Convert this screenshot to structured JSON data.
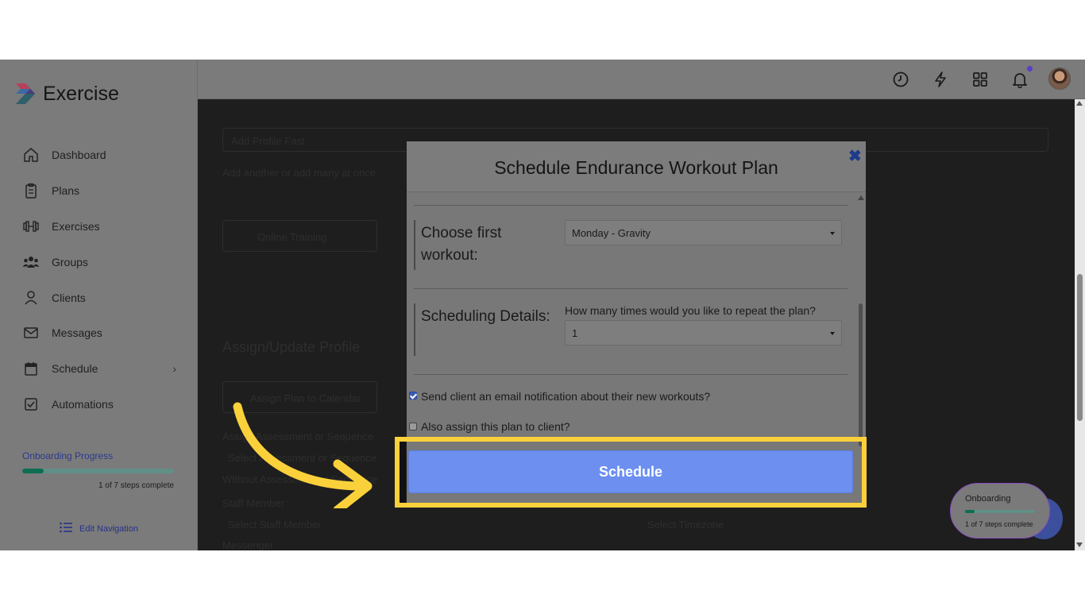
{
  "app": {
    "name": "Exercise"
  },
  "sidebar": {
    "items": [
      {
        "label": "Dashboard",
        "icon": "home-icon"
      },
      {
        "label": "Plans",
        "icon": "clipboard-icon"
      },
      {
        "label": "Exercises",
        "icon": "dumbbell-icon"
      },
      {
        "label": "Groups",
        "icon": "groups-icon"
      },
      {
        "label": "Clients",
        "icon": "user-icon"
      },
      {
        "label": "Messages",
        "icon": "mail-icon"
      },
      {
        "label": "Schedule",
        "icon": "calendar-icon"
      },
      {
        "label": "Automations",
        "icon": "checkbox-icon"
      }
    ],
    "onboarding": {
      "title": "Onboarding Progress",
      "steps": "1 of 7 steps complete",
      "progress": 0.14
    },
    "edit_nav": "Edit Navigation"
  },
  "topbar": {
    "icons": [
      "clock-icon",
      "bolt-icon",
      "grid-icon",
      "bell-icon",
      "avatar"
    ]
  },
  "background_page": {
    "texts": [
      "Add Profile Fast",
      "Add another or add many at once",
      "Online Training",
      "Assign/Update Profile",
      "Assign Plan to Calendar",
      "Assign Assessment or Sequence",
      "Select Assessment or Sequence",
      "Without Assessment or Sequence",
      "Staff Member",
      "Select Staff Member",
      "Select Timezone",
      "Messenger"
    ]
  },
  "modal": {
    "title": "Schedule Endurance Workout Plan",
    "close_icon": "close-icon",
    "first_workout": {
      "label": "Choose first workout:",
      "value": "Monday - Gravity"
    },
    "scheduling": {
      "label": "Scheduling Details:",
      "question": "How many times would you like to repeat the plan?",
      "value": "1"
    },
    "email_notification": {
      "label": "Send client an email notification about their new workouts?",
      "checked": true
    },
    "assign_plan": {
      "label": "Also assign this plan to client?",
      "checked": false
    },
    "schedule_button": "Schedule"
  },
  "onboarding_widget": {
    "title": "Onboarding",
    "steps": "1 of 7 steps complete"
  },
  "colors": {
    "accent": "#6c8ff0",
    "highlight": "#fbd13b",
    "brand_link": "#27318a"
  }
}
